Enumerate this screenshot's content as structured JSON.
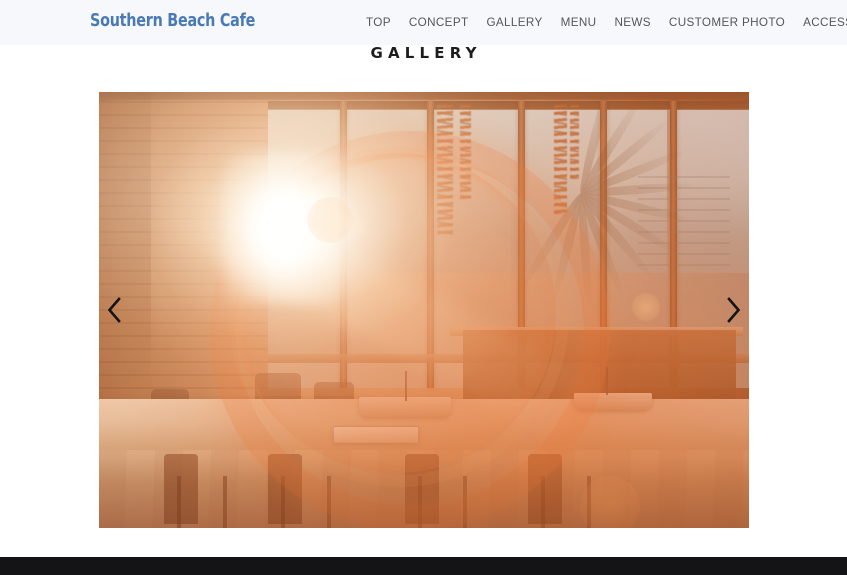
{
  "header": {
    "brand": "Southern Beach Cafe",
    "brand_color": "#4a7ab5",
    "background": "#f7f8fc",
    "nav": [
      {
        "label": "TOP",
        "name": "nav-item-top"
      },
      {
        "label": "CONCEPT",
        "name": "nav-item-concept"
      },
      {
        "label": "GALLERY",
        "name": "nav-item-gallery"
      },
      {
        "label": "MENU",
        "name": "nav-item-menu"
      },
      {
        "label": "NEWS",
        "name": "nav-item-news"
      },
      {
        "label": "CUSTOMER PHOTO",
        "name": "nav-item-customer-photo"
      },
      {
        "label": "ACCESS",
        "name": "nav-item-access"
      }
    ]
  },
  "main": {
    "page_title": "GALLERY",
    "title_color": "#1d1d1d",
    "slider": {
      "prev_icon": "chevron-left-icon",
      "next_icon": "chevron-right-icon",
      "arrow_color": "#141414",
      "slide": {
        "alt": "Sunlit cafe interior with long communal wooden table, model boats, chairs and tall sea-facing windows, heavy warm orange lens flare",
        "dominant_colors": [
          "#d7ae8b",
          "#e07030",
          "#8a5334",
          "#cde4ee"
        ]
      }
    }
  },
  "footer": {
    "background": "#141416"
  }
}
